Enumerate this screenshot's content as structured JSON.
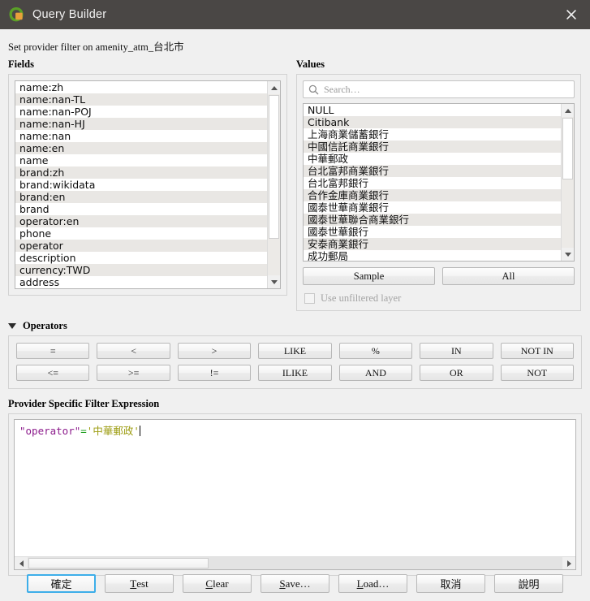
{
  "window": {
    "title": "Query Builder",
    "app_icon": "qgis-icon",
    "close_icon": "close-icon",
    "accent_color": "#3daee9",
    "titlebar_color": "#4a4745"
  },
  "provider_filter_label": "Set provider filter on amenity_atm_台北市",
  "fields": {
    "label": "Fields",
    "items": [
      "name:zh",
      "name:nan-TL",
      "name:nan-POJ",
      "name:nan-HJ",
      "name:nan",
      "name:en",
      "name",
      "brand:zh",
      "brand:wikidata",
      "brand:en",
      "brand",
      "operator:en",
      "phone",
      "operator",
      "description",
      "currency:TWD",
      "address"
    ]
  },
  "values": {
    "label": "Values",
    "search": {
      "placeholder": "Search…",
      "value": "",
      "icon": "search-icon"
    },
    "items": [
      "NULL",
      "Citibank",
      "上海商業儲蓄銀行",
      "中國信託商業銀行",
      "中華郵政",
      "台北富邦商業銀行",
      "台北富邦銀行",
      "合作金庫商業銀行",
      "國泰世華商業銀行",
      "國泰世華聯合商業銀行",
      "國泰世華銀行",
      "安泰商業銀行",
      "成功郵局"
    ],
    "sample_label": "Sample",
    "all_label": "All",
    "use_unfiltered_label": "Use unfiltered layer",
    "use_unfiltered_checked": false,
    "use_unfiltered_enabled": false
  },
  "operators": {
    "label": "Operators",
    "expanded": true,
    "collapse_icon": "triangle-down-icon",
    "row1": [
      "=",
      "<",
      ">",
      "LIKE",
      "%",
      "IN",
      "NOT IN"
    ],
    "row2": [
      "<=",
      ">=",
      "!=",
      "ILIKE",
      "AND",
      "OR",
      "NOT"
    ]
  },
  "expression": {
    "label": "Provider Specific Filter Expression",
    "value": "\"operator\"='中華郵政'",
    "tokens": {
      "field": "\"operator\"",
      "operator": "=",
      "string": "'中華郵政'"
    },
    "colors": {
      "field": "#8b1a8b",
      "operator": "#1e9e1e",
      "string": "#9c9c10"
    }
  },
  "bottom_buttons": [
    {
      "label": "確定",
      "mnemonic": "",
      "default": true
    },
    {
      "label": "Test",
      "mnemonic": "T",
      "default": false
    },
    {
      "label": "Clear",
      "mnemonic": "C",
      "default": false
    },
    {
      "label": "Save…",
      "mnemonic": "S",
      "default": false
    },
    {
      "label": "Load…",
      "mnemonic": "L",
      "default": false
    },
    {
      "label": "取消",
      "mnemonic": "",
      "default": false
    },
    {
      "label": "說明",
      "mnemonic": "",
      "default": false
    }
  ]
}
